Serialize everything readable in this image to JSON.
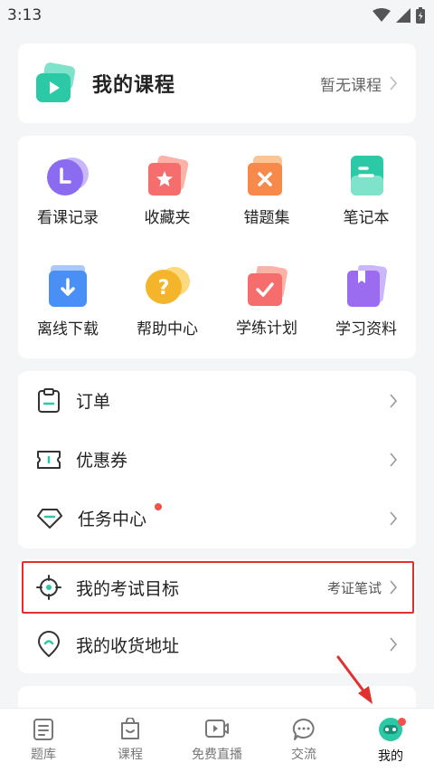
{
  "statusbar": {
    "time": "3:13"
  },
  "course": {
    "title": "我的课程",
    "status": "暂无课程"
  },
  "grid": [
    {
      "label": "看课记录",
      "icon": "history-icon",
      "color": "#8b6cf0"
    },
    {
      "label": "收藏夹",
      "icon": "favorite-star-icon",
      "color": "#f56d6d"
    },
    {
      "label": "错题集",
      "icon": "wrong-questions-icon",
      "color": "#f78a4b"
    },
    {
      "label": "笔记本",
      "icon": "notebook-icon",
      "color": "#2cc9a6"
    },
    {
      "label": "离线下载",
      "icon": "download-icon",
      "color": "#4a8ff5"
    },
    {
      "label": "帮助中心",
      "icon": "help-icon",
      "color": "#f5b52a"
    },
    {
      "label": "学练计划",
      "icon": "study-plan-icon",
      "color": "#f56d6d"
    },
    {
      "label": "学习资料",
      "icon": "study-materials-icon",
      "color": "#9b6cf0"
    }
  ],
  "menu": {
    "orders": "订单",
    "coupons": "优惠券",
    "tasks": "任务中心",
    "exam_goal": "我的考试目标",
    "exam_goal_value": "考证笔试",
    "address": "我的收货地址"
  },
  "tabs": [
    {
      "label": "题库",
      "icon": "question-bank-icon"
    },
    {
      "label": "课程",
      "icon": "course-bag-icon"
    },
    {
      "label": "免费直播",
      "icon": "live-video-icon"
    },
    {
      "label": "交流",
      "icon": "chat-bubble-icon"
    },
    {
      "label": "我的",
      "icon": "mascot-avatar-icon"
    }
  ],
  "colors": {
    "accent": "#2cc9a6",
    "highlight": "#e0312f",
    "badge": "#f2514c"
  }
}
